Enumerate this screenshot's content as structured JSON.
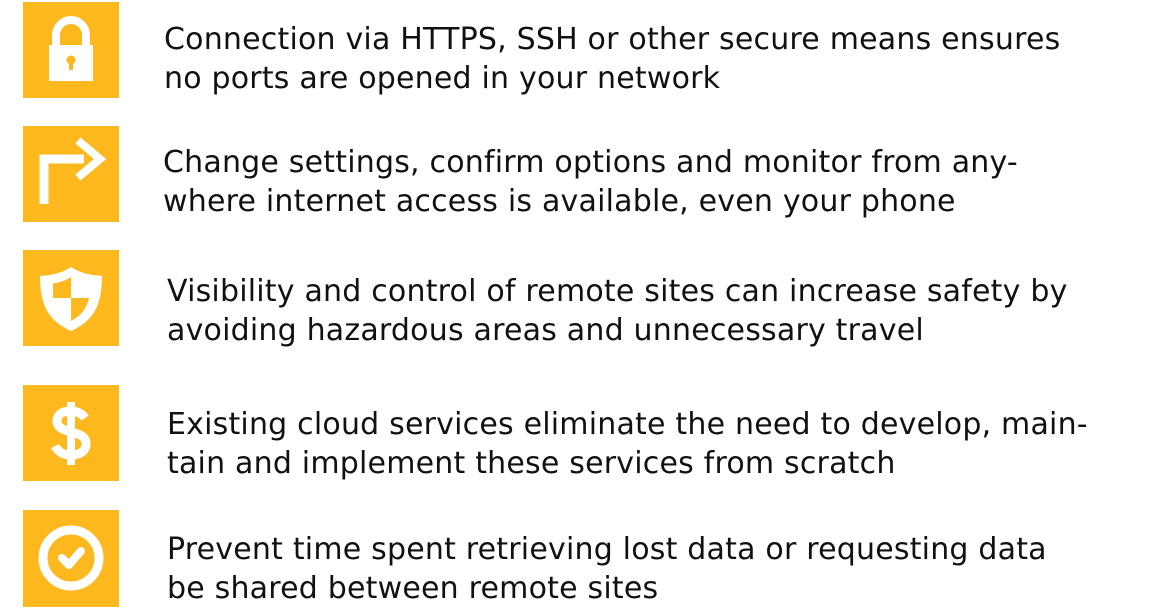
{
  "theme": {
    "accent": "#FDB81E",
    "icon_foreground": "#FFFFFF",
    "text_color": "#111111",
    "background": "#FFFFFF"
  },
  "features": [
    {
      "icon": "padlock-icon",
      "lines": [
        "Connection via HTTPS, SSH or other secure means ensures",
        "no ports are opened in your network"
      ]
    },
    {
      "icon": "turn-right-arrow-icon",
      "lines": [
        "Change settings, confirm options and monitor from any-",
        "where internet access is available, even your phone"
      ]
    },
    {
      "icon": "shield-icon",
      "lines": [
        "Visibility and control of remote sites can increase safety by",
        "avoiding hazardous areas and unnecessary travel"
      ]
    },
    {
      "icon": "dollar-sign-icon",
      "lines": [
        "Existing cloud services eliminate the need to develop, main-",
        "tain and implement these services from scratch"
      ]
    },
    {
      "icon": "clock-check-icon",
      "lines": [
        "Prevent time spent retrieving lost data or requesting data",
        "be  shared between remote sites"
      ]
    }
  ]
}
